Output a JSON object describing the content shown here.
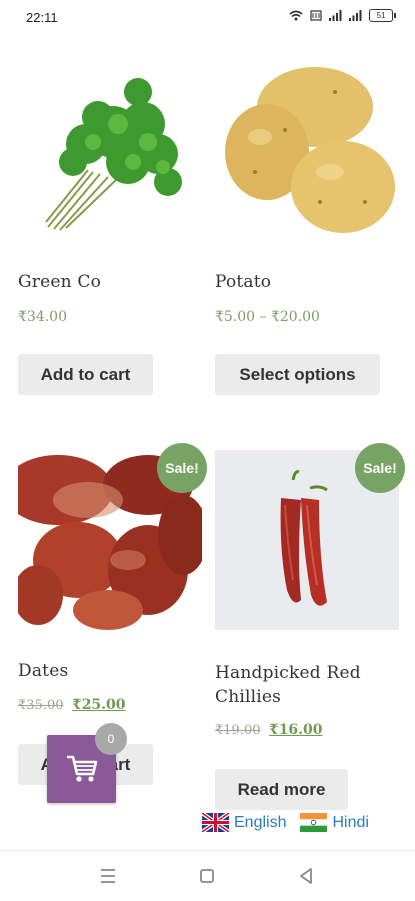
{
  "status_bar": {
    "time": "22:11",
    "battery": "51"
  },
  "products": [
    {
      "name": "Green Co",
      "price": "₹34.00",
      "button_label": "Add to cart",
      "image": "coriander-bunch",
      "on_sale": false
    },
    {
      "name": "Potato",
      "price": "₹5.00 – ₹20.00",
      "button_label": "Select options",
      "image": "potatoes",
      "on_sale": false
    },
    {
      "name": "Dates",
      "old_price": "₹35.00",
      "price": "₹25.00",
      "button_label": "Add to cart",
      "image": "dates",
      "on_sale": true,
      "badge": "Sale!"
    },
    {
      "name": "Handpicked Red Chillies",
      "old_price": "₹19.00",
      "price": "₹16.00",
      "button_label": "Read more",
      "image": "red-chillies",
      "on_sale": true,
      "badge": "Sale!"
    }
  ],
  "floating_cart": {
    "count": "0",
    "icon": "shopping-cart-icon"
  },
  "languages": [
    {
      "label": "English",
      "flag": "uk-flag-icon"
    },
    {
      "label": "Hindi",
      "flag": "india-flag-icon"
    }
  ],
  "colors": {
    "sale_badge": "#77a464",
    "price_green": "#7a9c66",
    "cart_purple": "#8c5998",
    "button_bg": "#ebebeb",
    "language_link": "#2b7bbd"
  }
}
